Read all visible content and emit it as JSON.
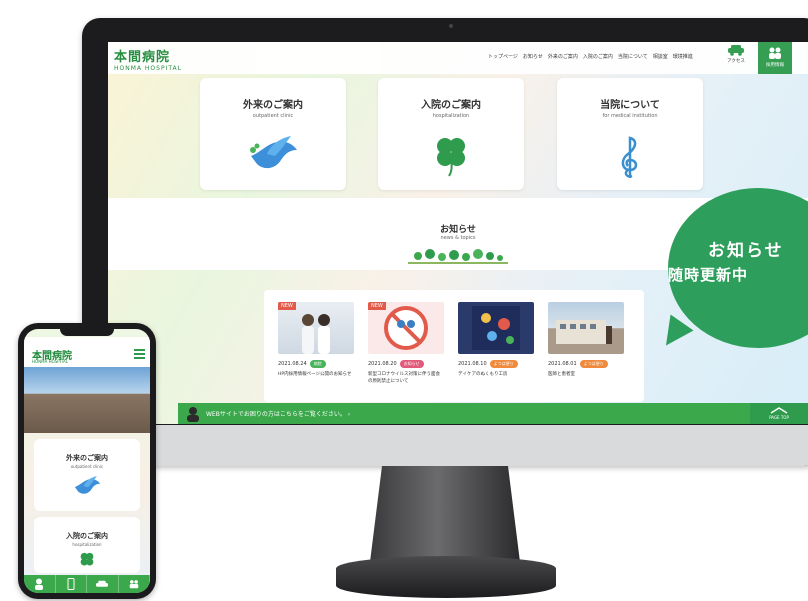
{
  "site": {
    "logo_jp": "本間病院",
    "logo_en": "HONMA HOSPITAL",
    "nav": [
      "トップページ",
      "お知らせ",
      "外来のご案内",
      "入院のご案内",
      "当院について",
      "相談室",
      "環境推進"
    ],
    "access_label": "アクセス",
    "recruit_label": "採用情報"
  },
  "cards": [
    {
      "title": "外来のご案内",
      "subtitle": "outpatient clinic",
      "icon": "dove-icon"
    },
    {
      "title": "入院のご案内",
      "subtitle": "hospitalization",
      "icon": "clover-icon"
    },
    {
      "title": "当院について",
      "subtitle": "for medical institution",
      "icon": "treble-clef-icon"
    }
  ],
  "news": {
    "title": "お知らせ",
    "subtitle": "news & topics",
    "items": [
      {
        "date": "2021.08.24",
        "badge": "病院",
        "badge_color": "#49b35a",
        "is_new": true,
        "new_label": "NEW",
        "text": "HP内採用情報ページ公開のお知らせ"
      },
      {
        "date": "2021.08.20",
        "badge": "お知らせ",
        "badge_color": "#e25a7a",
        "is_new": true,
        "new_label": "NEW",
        "text": "新型コロナウイルス対策に伴う面会の原則禁止について"
      },
      {
        "date": "2021.08.10",
        "badge": "よつば便り",
        "badge_color": "#f08a3c",
        "is_new": false,
        "text": "デイケアのぬくもり工房"
      },
      {
        "date": "2021.08.01",
        "badge": "よつば便り",
        "badge_color": "#f08a3c",
        "is_new": false,
        "text": "医師と患者室"
      }
    ]
  },
  "footer": {
    "message": "WEBサイトでお困りの方はこちらをご覧ください。 ›",
    "pagetop_label": "PAGE TOP"
  },
  "bubble": {
    "line1": "お知らせ",
    "line2": "随時更新中"
  },
  "phone": {
    "cards": [
      {
        "title": "外来のご案内",
        "subtitle": "outpatient clinic"
      },
      {
        "title": "入院のご案内",
        "subtitle": "hospitalization"
      }
    ]
  },
  "colors": {
    "brand_green": "#2f9b4c",
    "bubble_green": "#2d9e5b"
  }
}
